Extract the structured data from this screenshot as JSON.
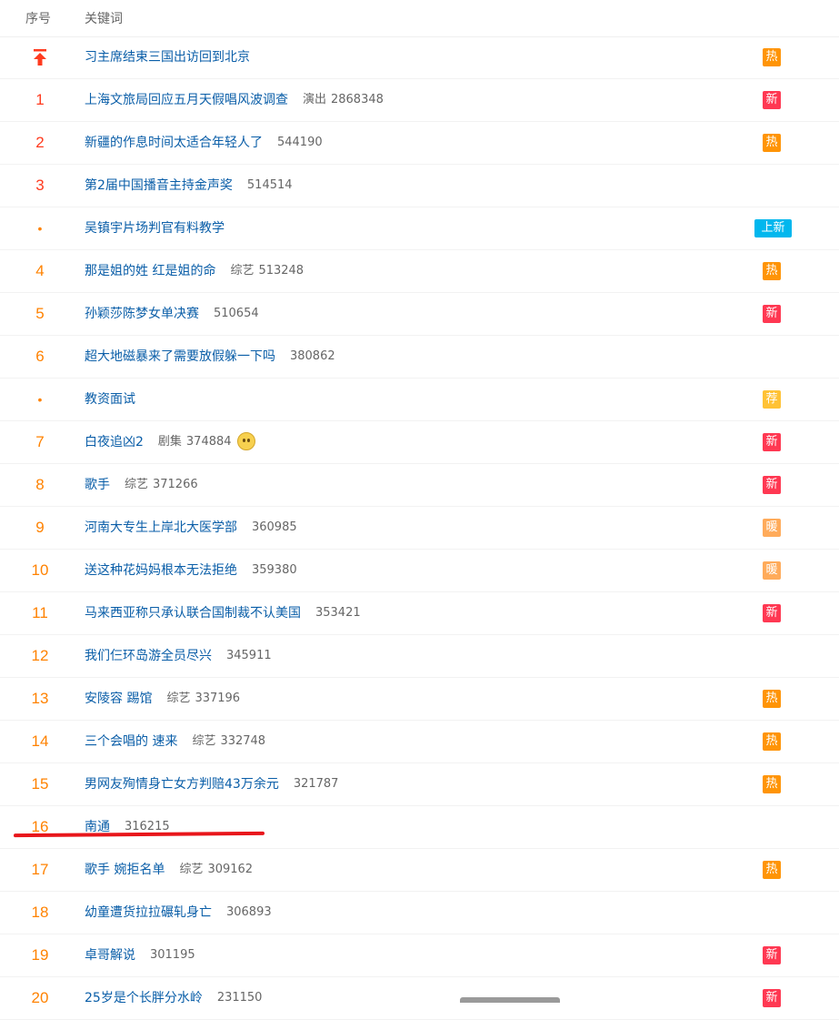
{
  "header": {
    "rank_label": "序号",
    "keyword_label": "关键词"
  },
  "colors": {
    "link": "#0a5ea8",
    "rank_top": "#ff3b1f",
    "rank_other": "#ff8200",
    "badge_hot": "#ff9406",
    "badge_new": "#ff3852",
    "badge_shangxin": "#00b7ee",
    "badge_jian": "#ffc235",
    "badge_nuan": "#ffab5a",
    "annotation": "#e8161b"
  },
  "rows": [
    {
      "rank": "",
      "type": "pinned",
      "keyword": "习主席结束三国出访回到北京",
      "category": "",
      "count": "",
      "badge": "热",
      "badge_type": "hot"
    },
    {
      "rank": "1",
      "type": "top",
      "keyword": "上海文旅局回应五月天假唱风波调查",
      "category": "演出",
      "count": "2868348",
      "badge": "新",
      "badge_type": "new"
    },
    {
      "rank": "2",
      "type": "top",
      "keyword": "新疆的作息时间太适合年轻人了",
      "category": "",
      "count": "544190",
      "badge": "热",
      "badge_type": "hot"
    },
    {
      "rank": "3",
      "type": "top",
      "keyword": "第2届中国播音主持金声奖",
      "category": "",
      "count": "514514",
      "badge": "",
      "badge_type": ""
    },
    {
      "rank": "•",
      "type": "dot",
      "keyword": "吴镇宇片场判官有料教学",
      "category": "",
      "count": "",
      "badge": "上新",
      "badge_type": "shangxin"
    },
    {
      "rank": "4",
      "type": "mid",
      "keyword": "那是姐的姓 红是姐的命",
      "category": "综艺",
      "count": "513248",
      "badge": "热",
      "badge_type": "hot"
    },
    {
      "rank": "5",
      "type": "mid",
      "keyword": "孙颖莎陈梦女单决赛",
      "category": "",
      "count": "510654",
      "badge": "新",
      "badge_type": "new"
    },
    {
      "rank": "6",
      "type": "mid",
      "keyword": "超大地磁暴来了需要放假躲一下吗",
      "category": "",
      "count": "380862",
      "badge": "",
      "badge_type": ""
    },
    {
      "rank": "•",
      "type": "dot",
      "keyword": "教资面试",
      "category": "",
      "count": "",
      "badge": "荐",
      "badge_type": "jian"
    },
    {
      "rank": "7",
      "type": "mid",
      "keyword": "白夜追凶2",
      "category": "剧集",
      "count": "374884",
      "badge": "新",
      "badge_type": "new",
      "emoji": "smile-emoji-icon"
    },
    {
      "rank": "8",
      "type": "mid",
      "keyword": "歌手",
      "category": "综艺",
      "count": "371266",
      "badge": "新",
      "badge_type": "new"
    },
    {
      "rank": "9",
      "type": "mid",
      "keyword": "河南大专生上岸北大医学部",
      "category": "",
      "count": "360985",
      "badge": "暖",
      "badge_type": "nuan"
    },
    {
      "rank": "10",
      "type": "mid",
      "keyword": "送这种花妈妈根本无法拒绝",
      "category": "",
      "count": "359380",
      "badge": "暖",
      "badge_type": "nuan"
    },
    {
      "rank": "11",
      "type": "mid",
      "keyword": "马来西亚称只承认联合国制裁不认美国",
      "category": "",
      "count": "353421",
      "badge": "新",
      "badge_type": "new"
    },
    {
      "rank": "12",
      "type": "mid",
      "keyword": "我们仨环岛游全员尽兴",
      "category": "",
      "count": "345911",
      "badge": "",
      "badge_type": ""
    },
    {
      "rank": "13",
      "type": "mid",
      "keyword": "安陵容 踢馆",
      "category": "综艺",
      "count": "337196",
      "badge": "热",
      "badge_type": "hot"
    },
    {
      "rank": "14",
      "type": "mid",
      "keyword": "三个会唱的 速来",
      "category": "综艺",
      "count": "332748",
      "badge": "热",
      "badge_type": "hot"
    },
    {
      "rank": "15",
      "type": "mid",
      "keyword": "男网友殉情身亡女方判赔43万余元",
      "category": "",
      "count": "321787",
      "badge": "热",
      "badge_type": "hot"
    },
    {
      "rank": "16",
      "type": "mid",
      "keyword": "南通",
      "category": "",
      "count": "316215",
      "badge": "",
      "badge_type": ""
    },
    {
      "rank": "17",
      "type": "mid",
      "keyword": "歌手 婉拒名单",
      "category": "综艺",
      "count": "309162",
      "badge": "热",
      "badge_type": "hot"
    },
    {
      "rank": "18",
      "type": "mid",
      "keyword": "幼童遭货拉拉碾轧身亡",
      "category": "",
      "count": "306893",
      "badge": "",
      "badge_type": ""
    },
    {
      "rank": "19",
      "type": "mid",
      "keyword": "卓哥解说",
      "category": "",
      "count": "301195",
      "badge": "新",
      "badge_type": "new"
    },
    {
      "rank": "20",
      "type": "mid",
      "keyword": "25岁是个长胖分水岭",
      "category": "",
      "count": "231150",
      "badge": "新",
      "badge_type": "new"
    }
  ]
}
